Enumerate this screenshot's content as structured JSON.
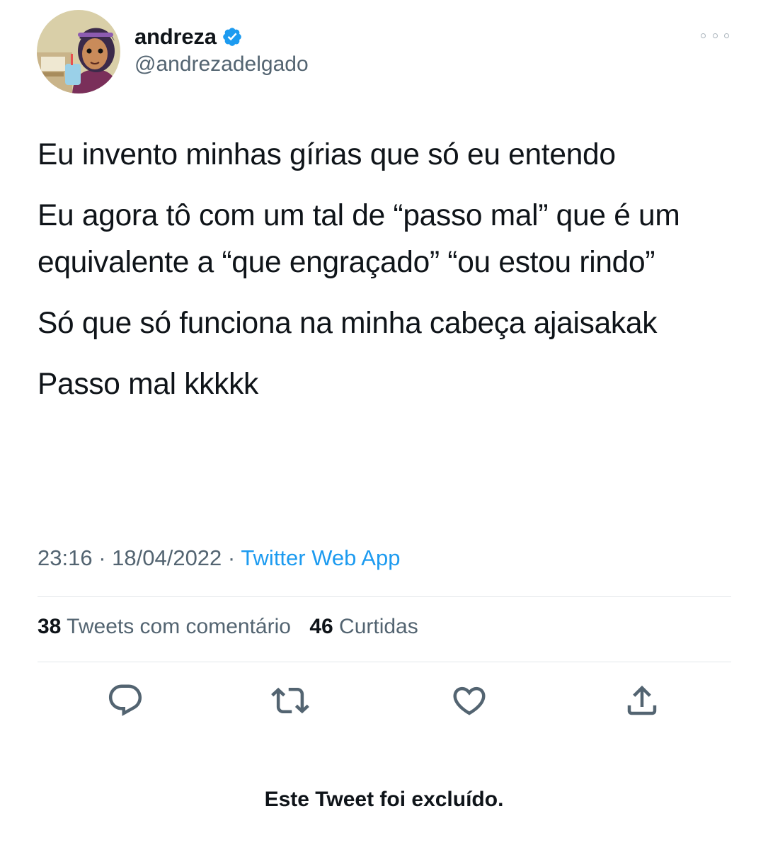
{
  "author": {
    "display_name": "andreza",
    "handle": "@andrezadelgado",
    "verified": true,
    "avatar": "cartoon-girl-avatar"
  },
  "tweet": {
    "paragraphs": [
      "Eu invento minhas gírias que só eu entendo",
      "Eu agora tô com um tal de “passo mal” que é um equivalente a “que engraçado” “ou estou rindo”",
      "Só que só funciona na minha cabeça ajaisakak",
      "Passo mal kkkkk"
    ],
    "time": "23:16",
    "date": "18/04/2022",
    "source": "Twitter Web App"
  },
  "stats": {
    "quote_count": "38",
    "quote_label": "Tweets com comentário",
    "like_count": "46",
    "like_label": "Curtidas"
  },
  "actions": [
    "reply-icon",
    "retweet-icon",
    "like-icon",
    "share-icon"
  ],
  "footer": {
    "deleted_notice": "Este Tweet foi excluído."
  },
  "colors": {
    "text": "#0f1419",
    "secondary": "#536471",
    "accent": "#1d9bf0"
  }
}
